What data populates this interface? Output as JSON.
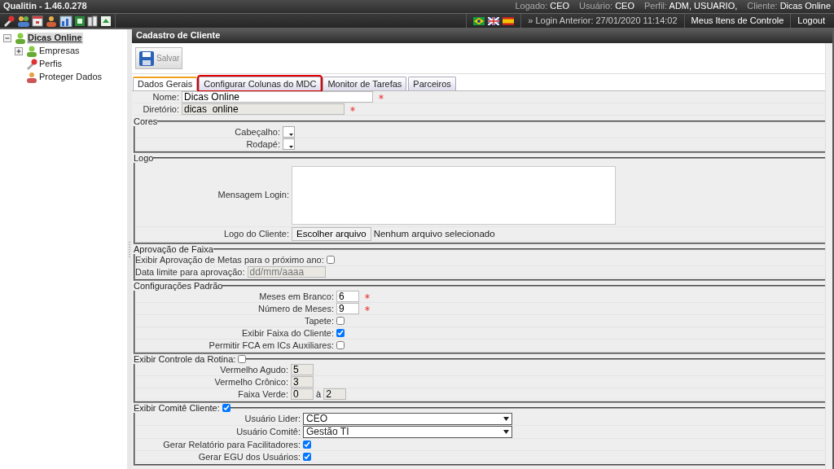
{
  "app": {
    "title": "Qualitin - 1.46.0.278"
  },
  "user_info": [
    {
      "label": "Logado:",
      "value": "CEO"
    },
    {
      "label": "Usuário:",
      "value": "CEO"
    },
    {
      "label": "Perfil:",
      "value": "ADM, USUARIO,"
    },
    {
      "label": "Cliente:",
      "value": "Dicas Online"
    }
  ],
  "login_info": "» Login Anterior: 27/01/2020 11:14:02",
  "top_links": [
    "Meus Itens de Controle",
    "Logout"
  ],
  "tree": [
    {
      "label": "Dicas Online",
      "expanded": true,
      "selected": true,
      "children": [
        {
          "label": "Empresas",
          "expanded": false,
          "selected": false
        },
        {
          "label": "Perfis",
          "selected": false
        },
        {
          "label": "Proteger Dados",
          "selected": false
        }
      ]
    }
  ],
  "panel": {
    "title": "Cadastro de Cliente",
    "save_button": "Salvar"
  },
  "tabs": [
    {
      "label": "Dados Gerais",
      "selected": true,
      "highlighted": false
    },
    {
      "label": "Configurar Colunas do MDC",
      "selected": false,
      "highlighted": true
    },
    {
      "label": "Monitor de Tarefas",
      "selected": false,
      "highlighted": false
    },
    {
      "label": "Parceiros",
      "selected": false,
      "highlighted": false
    }
  ],
  "sections": [
    {
      "rows": [
        {
          "kind": "text",
          "label": "Nome:",
          "value": "Dicas Online",
          "readonly": false,
          "required": true
        },
        {
          "kind": "text",
          "label": "Diretório:",
          "value": "dicas_online",
          "readonly": true,
          "required": true
        }
      ]
    },
    {
      "legend": {
        "text": "Cores"
      },
      "rows": [
        {
          "kind": "color",
          "label": "Cabeçalho:"
        },
        {
          "kind": "color",
          "label": "Rodapé:"
        }
      ]
    },
    {
      "legend": {
        "text": "Logo"
      },
      "rows": [
        {
          "kind": "textarea",
          "label": "Mensagem Login:"
        },
        {
          "kind": "file",
          "label": "Logo do Cliente:",
          "button": "Escolher arquivo",
          "status": "Nenhum arquivo selecionado"
        }
      ]
    },
    {
      "legend": {
        "text": "Aprovação de Faixa"
      },
      "rows": [
        {
          "kind": "checkbox",
          "label": "Exibir Aprovação de Metas para o próximo ano:",
          "checked": false
        },
        {
          "kind": "text",
          "label": "Data limite para aprovação:",
          "placeholder": "dd/mm/aaaa",
          "readonly": true,
          "required": false
        }
      ]
    },
    {
      "legend": {
        "text": "Configurações Padrão"
      },
      "rows": [
        {
          "kind": "text",
          "label": "Meses em Branco:",
          "value": "6",
          "readonly": false,
          "required": true
        },
        {
          "kind": "text",
          "label": "Número de Meses:",
          "value": "9",
          "readonly": false,
          "required": true
        },
        {
          "kind": "checkbox",
          "label": "Tapete:",
          "checked": false
        },
        {
          "kind": "checkbox",
          "label": "Exibir Faixa do Cliente:",
          "checked": true
        },
        {
          "kind": "checkbox",
          "label": "Permitir FCA em ICs Auxiliares:",
          "checked": false
        }
      ]
    },
    {
      "legend": {
        "text": "Exibir Controle da Rotina:",
        "checked": false
      },
      "rows": [
        {
          "kind": "text",
          "label": "Vermelho Agudo:",
          "value": "5",
          "readonly": true,
          "required": false
        },
        {
          "kind": "text",
          "label": "Vermelho Crônico:",
          "value": "3",
          "readonly": true,
          "required": false
        },
        {
          "kind": "range",
          "label": "Faixa Verde:",
          "from": "0",
          "separator": "à",
          "to": "2"
        }
      ]
    },
    {
      "legend": {
        "text": "Exibir Comitê Cliente:",
        "checked": true
      },
      "rows": [
        {
          "kind": "select",
          "label": "Usuário Lider:",
          "value": "CEO"
        },
        {
          "kind": "select",
          "label": "Usuário Comitê:",
          "value": "Gestão TI"
        },
        {
          "kind": "checkbox",
          "label": "Gerar Relatório para Facilitadores:",
          "checked": true
        },
        {
          "kind": "checkbox",
          "label": "Gerar EGU dos Usuários:",
          "checked": true
        }
      ]
    }
  ]
}
